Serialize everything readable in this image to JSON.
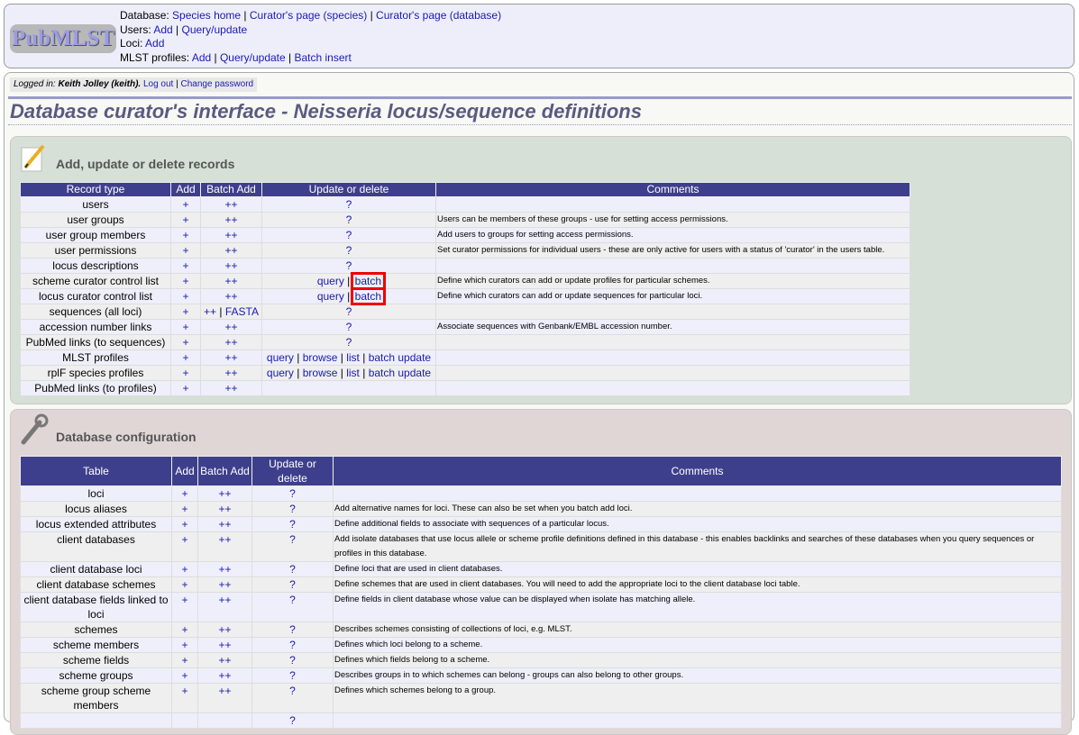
{
  "header": {
    "logo_text": "PubMLST",
    "menu": [
      {
        "label": "Database:",
        "links": [
          "Species home",
          "Curator's page (species)",
          "Curator's page (database)"
        ]
      },
      {
        "label": "Users:",
        "links": [
          "Add",
          "Query/update"
        ]
      },
      {
        "label": "Loci:",
        "links": [
          "Add"
        ]
      },
      {
        "label": "MLST profiles:",
        "links": [
          "Add",
          "Query/update",
          "Batch insert"
        ]
      }
    ]
  },
  "login": {
    "prefix": "Logged in:",
    "user": "Keith Jolley (keith).",
    "logout": "Log out",
    "change_password": "Change password"
  },
  "page_title": "Database curator's interface - Neisseria locus/sequence definitions",
  "records": {
    "heading": "Add, update or delete records",
    "icon": "pencil-icon",
    "columns": [
      "Record type",
      "Add",
      "Batch Add",
      "Update or delete",
      "Comments"
    ],
    "rows": [
      {
        "type": "users",
        "add": "+",
        "batch": [
          "++"
        ],
        "update": [
          "?"
        ],
        "comment": ""
      },
      {
        "type": "user groups",
        "add": "+",
        "batch": [
          "++"
        ],
        "update": [
          "?"
        ],
        "comment": "Users can be members of these groups - use for setting access permissions."
      },
      {
        "type": "user group members",
        "add": "+",
        "batch": [
          "++"
        ],
        "update": [
          "?"
        ],
        "comment": "Add users to groups for setting access permissions."
      },
      {
        "type": "user permissions",
        "add": "+",
        "batch": [
          "++"
        ],
        "update": [
          "?"
        ],
        "comment": "Set curator permissions for individual users - these are only active for users with a status of 'curator' in the users table."
      },
      {
        "type": "locus descriptions",
        "add": "+",
        "batch": [
          "++"
        ],
        "update": [
          "?"
        ],
        "comment": ""
      },
      {
        "type": "scheme curator control list",
        "add": "+",
        "batch": [
          "++"
        ],
        "update": [
          "query",
          "batch"
        ],
        "highlight": true,
        "comment": "Define which curators can add or update profiles for particular schemes."
      },
      {
        "type": "locus curator control list",
        "add": "+",
        "batch": [
          "++"
        ],
        "update": [
          "query",
          "batch"
        ],
        "highlight": true,
        "comment": "Define which curators can add or update sequences for particular loci."
      },
      {
        "type": "sequences (all loci)",
        "add": "+",
        "batch": [
          "++",
          "FASTA"
        ],
        "update": [
          "?"
        ],
        "comment": ""
      },
      {
        "type": "accession number links",
        "add": "+",
        "batch": [
          "++"
        ],
        "update": [
          "?"
        ],
        "comment": "Associate sequences with Genbank/EMBL accession number."
      },
      {
        "type": "PubMed links (to sequences)",
        "add": "+",
        "batch": [
          "++"
        ],
        "update": [
          "?"
        ],
        "comment": ""
      },
      {
        "type": "MLST profiles",
        "add": "+",
        "batch": [
          "++"
        ],
        "update": [
          "query",
          "browse",
          "list",
          "batch update"
        ],
        "comment": ""
      },
      {
        "type": "rplF species profiles",
        "add": "+",
        "batch": [
          "++"
        ],
        "update": [
          "query",
          "browse",
          "list",
          "batch update"
        ],
        "comment": ""
      },
      {
        "type": "PubMed links (to profiles)",
        "add": "+",
        "batch": [
          "++"
        ],
        "update": [],
        "comment": ""
      }
    ]
  },
  "config": {
    "heading": "Database configuration",
    "icon": "wrench-icon",
    "columns": [
      "Table",
      "Add",
      "Batch Add",
      "Update or delete",
      "Comments"
    ],
    "rows": [
      {
        "type": "loci",
        "add": "+",
        "batch": "++",
        "update": "?",
        "comment": ""
      },
      {
        "type": "locus aliases",
        "add": "+",
        "batch": "++",
        "update": "?",
        "comment": "Add alternative names for loci. These can also be set when you batch add loci."
      },
      {
        "type": "locus extended attributes",
        "add": "+",
        "batch": "++",
        "update": "?",
        "comment": "Define additional fields to associate with sequences of a particular locus."
      },
      {
        "type": "client databases",
        "add": "+",
        "batch": "++",
        "update": "?",
        "comment": "Add isolate databases that use locus allele or scheme profile definitions defined in this database - this enables backlinks and searches of these databases when you query sequences or profiles in this database."
      },
      {
        "type": "client database loci",
        "add": "+",
        "batch": "++",
        "update": "?",
        "comment": "Define loci that are used in client databases."
      },
      {
        "type": "client database schemes",
        "add": "+",
        "batch": "++",
        "update": "?",
        "comment": "Define schemes that are used in client databases. You will need to add the appropriate loci to the client database loci table."
      },
      {
        "type": "client database fields linked to loci",
        "add": "+",
        "batch": "++",
        "update": "?",
        "comment": "Define fields in client database whose value can be displayed when isolate has matching allele."
      },
      {
        "type": "schemes",
        "add": "+",
        "batch": "++",
        "update": "?",
        "comment": "Describes schemes consisting of collections of loci, e.g. MLST."
      },
      {
        "type": "scheme members",
        "add": "+",
        "batch": "++",
        "update": "?",
        "comment": "Defines which loci belong to a scheme."
      },
      {
        "type": "scheme fields",
        "add": "+",
        "batch": "++",
        "update": "?",
        "comment": "Defines which fields belong to a scheme."
      },
      {
        "type": "scheme groups",
        "add": "+",
        "batch": "++",
        "update": "?",
        "comment": "Describes groups in to which schemes can belong - groups can also belong to other groups."
      },
      {
        "type": "scheme group scheme members",
        "add": "+",
        "batch": "++",
        "update": "?",
        "comment": "Defines which schemes belong to a group."
      },
      {
        "type": "",
        "add": "",
        "batch": "",
        "update": "?",
        "comment": ""
      }
    ]
  }
}
